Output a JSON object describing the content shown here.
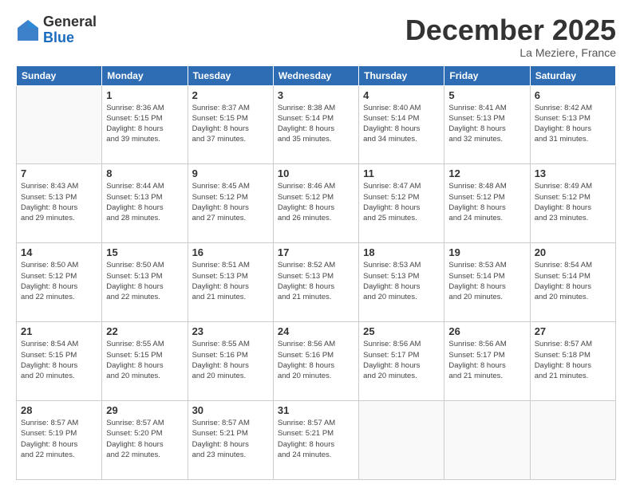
{
  "logo": {
    "general": "General",
    "blue": "Blue"
  },
  "title": "December 2025",
  "location": "La Meziere, France",
  "headers": [
    "Sunday",
    "Monday",
    "Tuesday",
    "Wednesday",
    "Thursday",
    "Friday",
    "Saturday"
  ],
  "weeks": [
    [
      {
        "day": "",
        "info": ""
      },
      {
        "day": "1",
        "info": "Sunrise: 8:36 AM\nSunset: 5:15 PM\nDaylight: 8 hours\nand 39 minutes."
      },
      {
        "day": "2",
        "info": "Sunrise: 8:37 AM\nSunset: 5:15 PM\nDaylight: 8 hours\nand 37 minutes."
      },
      {
        "day": "3",
        "info": "Sunrise: 8:38 AM\nSunset: 5:14 PM\nDaylight: 8 hours\nand 35 minutes."
      },
      {
        "day": "4",
        "info": "Sunrise: 8:40 AM\nSunset: 5:14 PM\nDaylight: 8 hours\nand 34 minutes."
      },
      {
        "day": "5",
        "info": "Sunrise: 8:41 AM\nSunset: 5:13 PM\nDaylight: 8 hours\nand 32 minutes."
      },
      {
        "day": "6",
        "info": "Sunrise: 8:42 AM\nSunset: 5:13 PM\nDaylight: 8 hours\nand 31 minutes."
      }
    ],
    [
      {
        "day": "7",
        "info": "Sunrise: 8:43 AM\nSunset: 5:13 PM\nDaylight: 8 hours\nand 29 minutes."
      },
      {
        "day": "8",
        "info": "Sunrise: 8:44 AM\nSunset: 5:13 PM\nDaylight: 8 hours\nand 28 minutes."
      },
      {
        "day": "9",
        "info": "Sunrise: 8:45 AM\nSunset: 5:12 PM\nDaylight: 8 hours\nand 27 minutes."
      },
      {
        "day": "10",
        "info": "Sunrise: 8:46 AM\nSunset: 5:12 PM\nDaylight: 8 hours\nand 26 minutes."
      },
      {
        "day": "11",
        "info": "Sunrise: 8:47 AM\nSunset: 5:12 PM\nDaylight: 8 hours\nand 25 minutes."
      },
      {
        "day": "12",
        "info": "Sunrise: 8:48 AM\nSunset: 5:12 PM\nDaylight: 8 hours\nand 24 minutes."
      },
      {
        "day": "13",
        "info": "Sunrise: 8:49 AM\nSunset: 5:12 PM\nDaylight: 8 hours\nand 23 minutes."
      }
    ],
    [
      {
        "day": "14",
        "info": "Sunrise: 8:50 AM\nSunset: 5:12 PM\nDaylight: 8 hours\nand 22 minutes."
      },
      {
        "day": "15",
        "info": "Sunrise: 8:50 AM\nSunset: 5:13 PM\nDaylight: 8 hours\nand 22 minutes."
      },
      {
        "day": "16",
        "info": "Sunrise: 8:51 AM\nSunset: 5:13 PM\nDaylight: 8 hours\nand 21 minutes."
      },
      {
        "day": "17",
        "info": "Sunrise: 8:52 AM\nSunset: 5:13 PM\nDaylight: 8 hours\nand 21 minutes."
      },
      {
        "day": "18",
        "info": "Sunrise: 8:53 AM\nSunset: 5:13 PM\nDaylight: 8 hours\nand 20 minutes."
      },
      {
        "day": "19",
        "info": "Sunrise: 8:53 AM\nSunset: 5:14 PM\nDaylight: 8 hours\nand 20 minutes."
      },
      {
        "day": "20",
        "info": "Sunrise: 8:54 AM\nSunset: 5:14 PM\nDaylight: 8 hours\nand 20 minutes."
      }
    ],
    [
      {
        "day": "21",
        "info": "Sunrise: 8:54 AM\nSunset: 5:15 PM\nDaylight: 8 hours\nand 20 minutes."
      },
      {
        "day": "22",
        "info": "Sunrise: 8:55 AM\nSunset: 5:15 PM\nDaylight: 8 hours\nand 20 minutes."
      },
      {
        "day": "23",
        "info": "Sunrise: 8:55 AM\nSunset: 5:16 PM\nDaylight: 8 hours\nand 20 minutes."
      },
      {
        "day": "24",
        "info": "Sunrise: 8:56 AM\nSunset: 5:16 PM\nDaylight: 8 hours\nand 20 minutes."
      },
      {
        "day": "25",
        "info": "Sunrise: 8:56 AM\nSunset: 5:17 PM\nDaylight: 8 hours\nand 20 minutes."
      },
      {
        "day": "26",
        "info": "Sunrise: 8:56 AM\nSunset: 5:17 PM\nDaylight: 8 hours\nand 21 minutes."
      },
      {
        "day": "27",
        "info": "Sunrise: 8:57 AM\nSunset: 5:18 PM\nDaylight: 8 hours\nand 21 minutes."
      }
    ],
    [
      {
        "day": "28",
        "info": "Sunrise: 8:57 AM\nSunset: 5:19 PM\nDaylight: 8 hours\nand 22 minutes."
      },
      {
        "day": "29",
        "info": "Sunrise: 8:57 AM\nSunset: 5:20 PM\nDaylight: 8 hours\nand 22 minutes."
      },
      {
        "day": "30",
        "info": "Sunrise: 8:57 AM\nSunset: 5:21 PM\nDaylight: 8 hours\nand 23 minutes."
      },
      {
        "day": "31",
        "info": "Sunrise: 8:57 AM\nSunset: 5:21 PM\nDaylight: 8 hours\nand 24 minutes."
      },
      {
        "day": "",
        "info": ""
      },
      {
        "day": "",
        "info": ""
      },
      {
        "day": "",
        "info": ""
      }
    ]
  ]
}
